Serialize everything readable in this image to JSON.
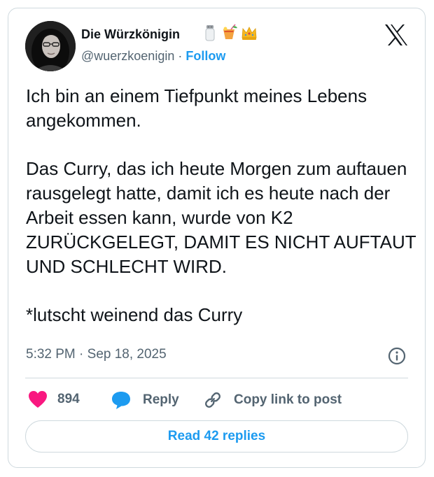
{
  "author": {
    "name": "Die Würzkönigin",
    "handle": "@wuerzkoenigin",
    "separator": "·",
    "follow_label": "Follow",
    "emoji_icons": [
      "salt-shaker-icon",
      "tropical-drink-icon",
      "crown-icon"
    ]
  },
  "tweet": {
    "paragraphs": [
      "Ich bin an einem Tiefpunkt meines Lebens angekommen.",
      "Das Curry, das ich heute Morgen zum auftauen rausgelegt hatte, damit ich es heute nach der Arbeit essen kann, wurde von K2 ZURÜCKGELEGT, DAMIT ES NICHT AUFTAUT UND SCHLECHT WIRD.",
      "*lutscht weinend das Curry"
    ],
    "timestamp": "5:32 PM · Sep 18, 2025"
  },
  "actions": {
    "like_count": "894",
    "reply_label": "Reply",
    "copy_label": "Copy link to post",
    "read_replies_label": "Read 42 replies"
  },
  "colors": {
    "accent": "#1d9bf0",
    "like": "#f91880",
    "text": "#0f1419",
    "secondary": "#536471",
    "border": "#cfd9de"
  }
}
